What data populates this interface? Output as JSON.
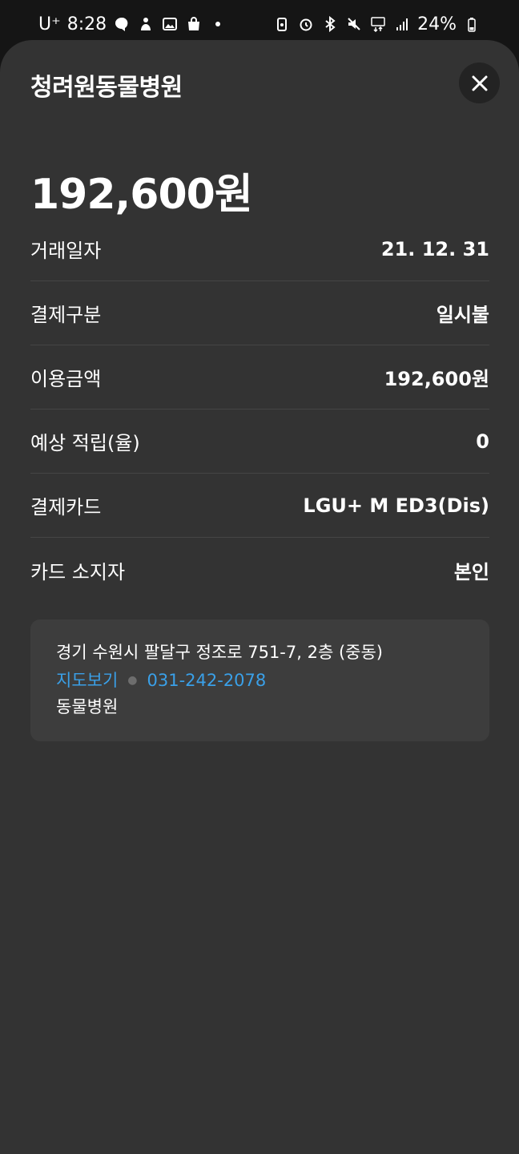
{
  "statusbar": {
    "carrier": "U⁺",
    "time": "8:28",
    "battery": "24%"
  },
  "sheet": {
    "title": "청려원동물병원",
    "amount": "192,600원",
    "rows": [
      {
        "label": "거래일자",
        "value": "21. 12. 31"
      },
      {
        "label": "결제구분",
        "value": "일시불"
      },
      {
        "label": "이용금액",
        "value": "192,600원"
      },
      {
        "label": "예상 적립(율)",
        "value": "0"
      },
      {
        "label": "결제카드",
        "value": "LGU+ M ED3(Dis)"
      },
      {
        "label": "카드 소지자",
        "value": "본인"
      }
    ],
    "info": {
      "address": "경기 수원시 팔달구 정조로 751-7, 2층 (중동)",
      "map_link": "지도보기",
      "phone": "031-242-2078",
      "category": "동물병원"
    }
  },
  "colors": {
    "sheet_bg": "#333333",
    "box_bg": "#3d3d3d",
    "link": "#3aa0e8"
  }
}
